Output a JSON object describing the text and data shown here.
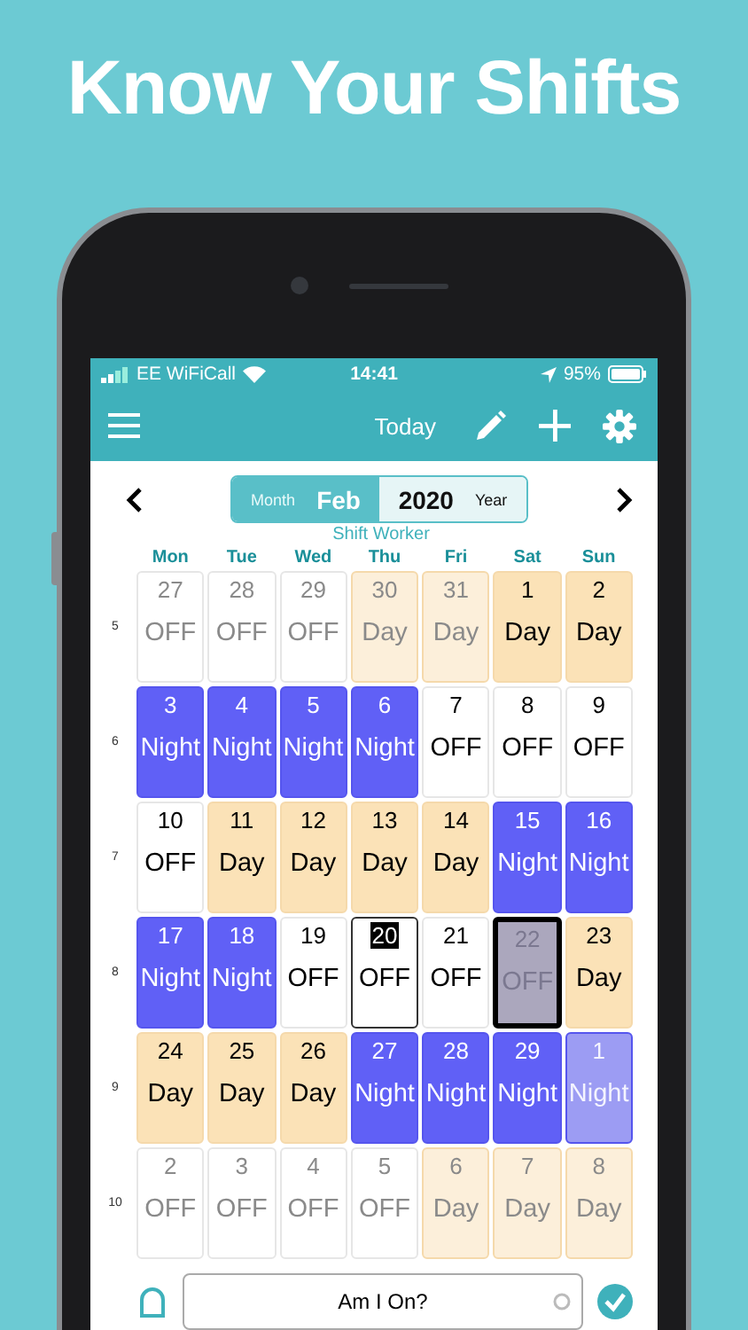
{
  "headline": "Know Your Shifts",
  "status_bar": {
    "carrier": "EE WiFiCall",
    "time": "14:41",
    "battery": "95%"
  },
  "nav_bar": {
    "today_button": "Today"
  },
  "period": {
    "month_label": "Month",
    "month": "Feb",
    "year": "2020",
    "year_label": "Year",
    "subtitle": "Shift Worker"
  },
  "weekdays": [
    "Mon",
    "Tue",
    "Wed",
    "Thu",
    "Fri",
    "Sat",
    "Sun"
  ],
  "weeks": [
    {
      "number": "5",
      "days": [
        {
          "date": "27",
          "shift": "OFF",
          "kind": "off",
          "current_month": false,
          "today": false,
          "selected": false
        },
        {
          "date": "28",
          "shift": "OFF",
          "kind": "off",
          "current_month": false,
          "today": false,
          "selected": false
        },
        {
          "date": "29",
          "shift": "OFF",
          "kind": "off",
          "current_month": false,
          "today": false,
          "selected": false
        },
        {
          "date": "30",
          "shift": "Day",
          "kind": "day",
          "current_month": false,
          "today": false,
          "selected": false
        },
        {
          "date": "31",
          "shift": "Day",
          "kind": "day",
          "current_month": false,
          "today": false,
          "selected": false
        },
        {
          "date": "1",
          "shift": "Day",
          "kind": "day",
          "current_month": true,
          "today": false,
          "selected": false
        },
        {
          "date": "2",
          "shift": "Day",
          "kind": "day",
          "current_month": true,
          "today": false,
          "selected": false
        }
      ]
    },
    {
      "number": "6",
      "days": [
        {
          "date": "3",
          "shift": "Night",
          "kind": "night",
          "current_month": true,
          "today": false,
          "selected": false
        },
        {
          "date": "4",
          "shift": "Night",
          "kind": "night",
          "current_month": true,
          "today": false,
          "selected": false
        },
        {
          "date": "5",
          "shift": "Night",
          "kind": "night",
          "current_month": true,
          "today": false,
          "selected": false
        },
        {
          "date": "6",
          "shift": "Night",
          "kind": "night",
          "current_month": true,
          "today": false,
          "selected": false
        },
        {
          "date": "7",
          "shift": "OFF",
          "kind": "off",
          "current_month": true,
          "today": false,
          "selected": false
        },
        {
          "date": "8",
          "shift": "OFF",
          "kind": "off",
          "current_month": true,
          "today": false,
          "selected": false
        },
        {
          "date": "9",
          "shift": "OFF",
          "kind": "off",
          "current_month": true,
          "today": false,
          "selected": false
        }
      ]
    },
    {
      "number": "7",
      "days": [
        {
          "date": "10",
          "shift": "OFF",
          "kind": "off",
          "current_month": true,
          "today": false,
          "selected": false
        },
        {
          "date": "11",
          "shift": "Day",
          "kind": "day",
          "current_month": true,
          "today": false,
          "selected": false
        },
        {
          "date": "12",
          "shift": "Day",
          "kind": "day",
          "current_month": true,
          "today": false,
          "selected": false
        },
        {
          "date": "13",
          "shift": "Day",
          "kind": "day",
          "current_month": true,
          "today": false,
          "selected": false
        },
        {
          "date": "14",
          "shift": "Day",
          "kind": "day",
          "current_month": true,
          "today": false,
          "selected": false
        },
        {
          "date": "15",
          "shift": "Night",
          "kind": "night",
          "current_month": true,
          "today": false,
          "selected": false
        },
        {
          "date": "16",
          "shift": "Night",
          "kind": "night",
          "current_month": true,
          "today": false,
          "selected": false
        }
      ]
    },
    {
      "number": "8",
      "days": [
        {
          "date": "17",
          "shift": "Night",
          "kind": "night",
          "current_month": true,
          "today": false,
          "selected": false
        },
        {
          "date": "18",
          "shift": "Night",
          "kind": "night",
          "current_month": true,
          "today": false,
          "selected": false
        },
        {
          "date": "19",
          "shift": "OFF",
          "kind": "off",
          "current_month": true,
          "today": false,
          "selected": false
        },
        {
          "date": "20",
          "shift": "OFF",
          "kind": "off",
          "current_month": true,
          "today": true,
          "selected": false
        },
        {
          "date": "21",
          "shift": "OFF",
          "kind": "off",
          "current_month": true,
          "today": false,
          "selected": false
        },
        {
          "date": "22",
          "shift": "OFF",
          "kind": "off",
          "current_month": true,
          "today": false,
          "selected": true
        },
        {
          "date": "23",
          "shift": "Day",
          "kind": "day",
          "current_month": true,
          "today": false,
          "selected": false
        }
      ]
    },
    {
      "number": "9",
      "days": [
        {
          "date": "24",
          "shift": "Day",
          "kind": "day",
          "current_month": true,
          "today": false,
          "selected": false
        },
        {
          "date": "25",
          "shift": "Day",
          "kind": "day",
          "current_month": true,
          "today": false,
          "selected": false
        },
        {
          "date": "26",
          "shift": "Day",
          "kind": "day",
          "current_month": true,
          "today": false,
          "selected": false
        },
        {
          "date": "27",
          "shift": "Night",
          "kind": "night",
          "current_month": true,
          "today": false,
          "selected": false
        },
        {
          "date": "28",
          "shift": "Night",
          "kind": "night",
          "current_month": true,
          "today": false,
          "selected": false
        },
        {
          "date": "29",
          "shift": "Night",
          "kind": "night",
          "current_month": true,
          "today": false,
          "selected": false
        },
        {
          "date": "1",
          "shift": "Night",
          "kind": "night",
          "current_month": false,
          "today": false,
          "selected": false
        }
      ]
    },
    {
      "number": "10",
      "days": [
        {
          "date": "2",
          "shift": "OFF",
          "kind": "off",
          "current_month": false,
          "today": false,
          "selected": false
        },
        {
          "date": "3",
          "shift": "OFF",
          "kind": "off",
          "current_month": false,
          "today": false,
          "selected": false
        },
        {
          "date": "4",
          "shift": "OFF",
          "kind": "off",
          "current_month": false,
          "today": false,
          "selected": false
        },
        {
          "date": "5",
          "shift": "OFF",
          "kind": "off",
          "current_month": false,
          "today": false,
          "selected": false
        },
        {
          "date": "6",
          "shift": "Day",
          "kind": "day",
          "current_month": false,
          "today": false,
          "selected": false
        },
        {
          "date": "7",
          "shift": "Day",
          "kind": "day",
          "current_month": false,
          "today": false,
          "selected": false
        },
        {
          "date": "8",
          "shift": "Day",
          "kind": "day",
          "current_month": false,
          "today": false,
          "selected": false
        }
      ]
    }
  ],
  "search": {
    "value": "Am I On?"
  }
}
